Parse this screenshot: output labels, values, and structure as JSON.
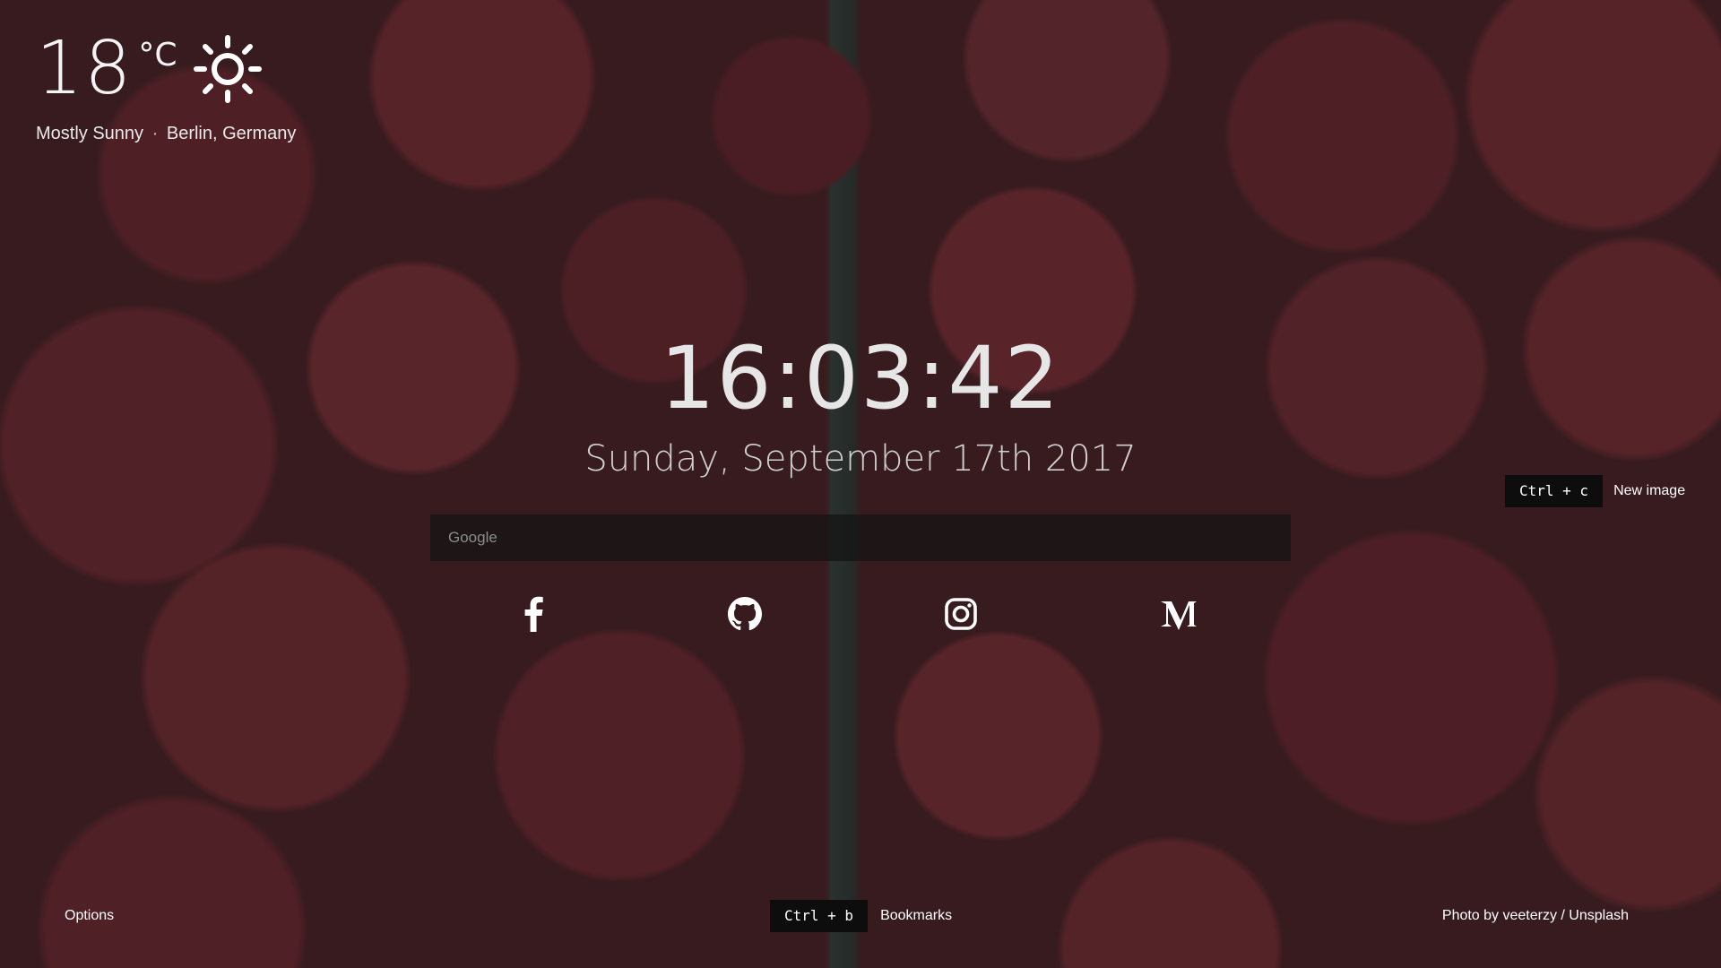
{
  "weather": {
    "temperature": "18",
    "unit": "°C",
    "condition": "Mostly Sunny",
    "separator": "·",
    "location": "Berlin, Germany",
    "icon": "sun-icon"
  },
  "clock": {
    "time": "16:03:42",
    "date": "Sunday, September 17th 2017"
  },
  "search": {
    "placeholder": "Google",
    "value": ""
  },
  "links": [
    {
      "name": "Facebook",
      "icon": "facebook-icon"
    },
    {
      "name": "GitHub",
      "icon": "github-icon"
    },
    {
      "name": "Instagram",
      "icon": "instagram-icon"
    },
    {
      "name": "Medium",
      "icon": "medium-icon"
    }
  ],
  "shortcuts": {
    "new_image": {
      "keys": "Ctrl + c",
      "label": "New image"
    },
    "bookmarks": {
      "keys": "Ctrl + b",
      "label": "Bookmarks"
    }
  },
  "footer": {
    "options_label": "Options",
    "credit": "Photo by veeterzy / Unsplash"
  },
  "colors": {
    "overlay": "#1e1e1e",
    "key_background": "#0d0d0d",
    "text": "#ffffff"
  }
}
